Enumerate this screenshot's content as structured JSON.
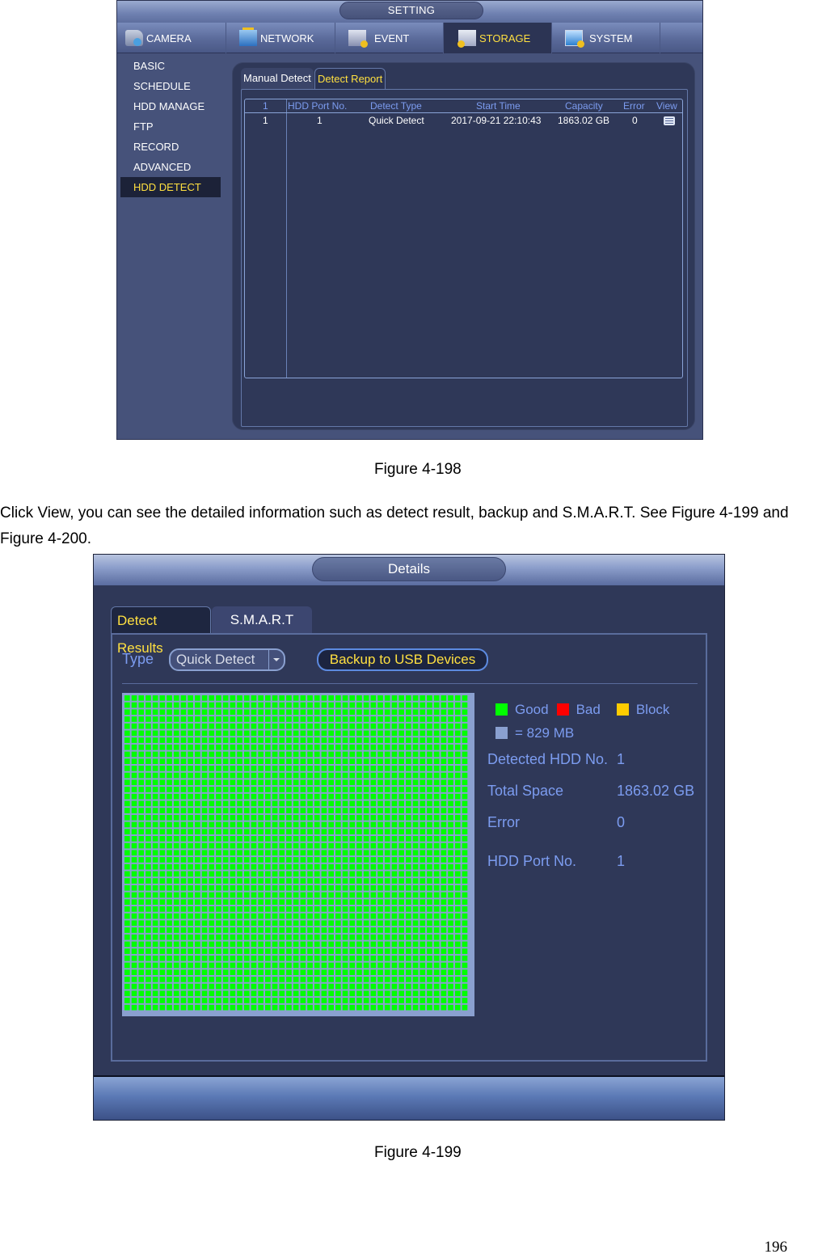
{
  "figure_198": {
    "window_title": "SETTING",
    "main_tabs": [
      {
        "label": "CAMERA",
        "icon": "camera-icon",
        "active": false
      },
      {
        "label": "NETWORK",
        "icon": "network-icon",
        "active": false
      },
      {
        "label": "EVENT",
        "icon": "event-icon",
        "active": false
      },
      {
        "label": "STORAGE",
        "icon": "storage-icon",
        "active": true
      },
      {
        "label": "SYSTEM",
        "icon": "system-icon",
        "active": false
      }
    ],
    "sidebar": {
      "items": [
        {
          "label": "BASIC"
        },
        {
          "label": "SCHEDULE"
        },
        {
          "label": "HDD MANAGE"
        },
        {
          "label": "FTP"
        },
        {
          "label": "RECORD"
        },
        {
          "label": "ADVANCED"
        },
        {
          "label": "HDD DETECT",
          "active": true
        }
      ]
    },
    "sub_tabs": [
      {
        "label": "Manual Detect",
        "active": false
      },
      {
        "label": "Detect Report",
        "active": true
      }
    ],
    "table": {
      "columns": [
        "1",
        "HDD Port No.",
        "Detect Type",
        "Start Time",
        "Capacity",
        "Error",
        "View"
      ],
      "rows": [
        {
          "index": "1",
          "port": "1",
          "type": "Quick Detect",
          "start_time": "2017-09-21 22:10:43",
          "capacity": "1863.02 GB",
          "error": "0",
          "view_icon": "list-icon"
        }
      ]
    },
    "caption": "Figure 4-198"
  },
  "paragraph": "Click View, you can see the detailed information such as detect result, backup and S.M.A.R.T. See Figure 4-199 and Figure 4-200.",
  "figure_199": {
    "window_title": "Details",
    "tabs": [
      {
        "label": "Detect Results",
        "active": true
      },
      {
        "label": "S.M.A.R.T",
        "active": false
      }
    ],
    "type_label": "Type",
    "type_select_value": "Quick Detect",
    "backup_button": "Backup to USB Devices",
    "legend": {
      "good": {
        "label": "Good",
        "color": "#00ff00"
      },
      "bad": {
        "label": "Bad",
        "color": "#ff0000"
      },
      "block": {
        "label": "Block",
        "color": "#ffcc00"
      },
      "unit": {
        "label": "= 829 MB",
        "color": "#8aa0d0"
      }
    },
    "grid_status": "all-good",
    "info": [
      {
        "label": "Detected HDD No.",
        "value": "1"
      },
      {
        "label": "Total Space",
        "value": "1863.02 GB"
      },
      {
        "label": "Error",
        "value": "0"
      },
      {
        "label": "HDD Port No.",
        "value": "1"
      }
    ],
    "caption": "Figure 4-199"
  },
  "page_number": "196"
}
